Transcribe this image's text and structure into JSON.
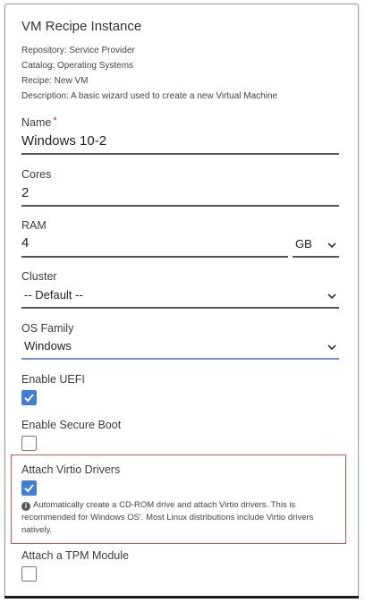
{
  "form": {
    "title": "VM Recipe Instance",
    "repository": "Repository: Service Provider",
    "catalog": "Catalog: Operating Systems",
    "recipe": "Recipe: New VM",
    "description": "Description: A basic wizard used to create a new Virtual Machine"
  },
  "fields": {
    "name": {
      "label": "Name",
      "required_mark": "*",
      "value": "Windows 10-2"
    },
    "cores": {
      "label": "Cores",
      "value": "2"
    },
    "ram": {
      "label": "RAM",
      "value": "4",
      "unit": "GB"
    },
    "cluster": {
      "label": "Cluster",
      "value": "-- Default --"
    },
    "os_family": {
      "label": "OS Family",
      "value": "Windows"
    },
    "enable_uefi": {
      "label": "Enable UEFI",
      "checked": true
    },
    "enable_secure_boot": {
      "label": "Enable Secure Boot",
      "checked": false
    },
    "attach_virtio": {
      "label": "Attach Virtio Drivers",
      "checked": true,
      "help": "Automatically create a CD-ROM drive and attach Virtio drivers. This is recommended for Windows OS'. Most Linux distributions include Virtio drivers natively."
    },
    "attach_tpm": {
      "label": "Attach a TPM Module",
      "checked": false
    }
  },
  "colors": {
    "checkbox_checked": "#3f7fd9",
    "highlight_border": "#d9534f",
    "focused_underline": "#6f8fd8"
  },
  "icons": {
    "check": "checkmark-icon",
    "chevron": "chevron-down-icon",
    "info": "info-icon"
  }
}
